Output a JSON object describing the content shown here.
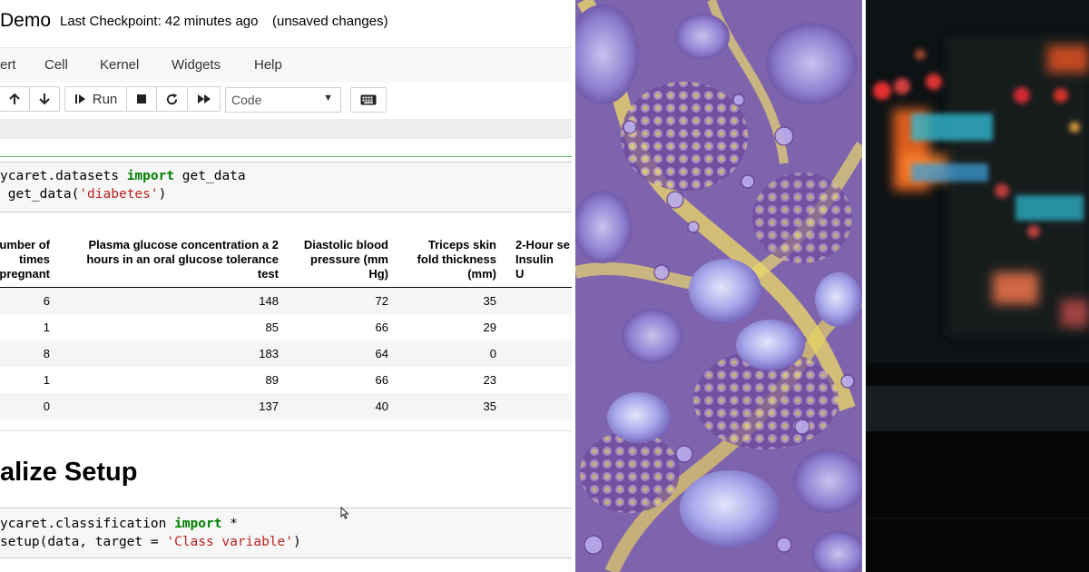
{
  "header": {
    "title": "Demo",
    "checkpoint": "Last Checkpoint: 42 minutes ago",
    "unsaved": "(unsaved changes)"
  },
  "menu": [
    "ert",
    "Cell",
    "Kernel",
    "Widgets",
    "Help"
  ],
  "toolbar": {
    "run_label": "Run",
    "cell_type": "Code",
    "icons": [
      "arrow-up-icon",
      "arrow-down-icon",
      "run-icon",
      "stop-icon",
      "restart-icon",
      "fast-forward-icon",
      "keyboard-icon"
    ]
  },
  "cells": {
    "load_data": {
      "line1_pre": "ycaret.datasets ",
      "line1_kw": "import",
      "line1_post": " get_data",
      "line2_pre": " get_data(",
      "line2_str": "'diabetes'",
      "line2_post": ")"
    },
    "setup": {
      "line1_pre": "ycaret.classification ",
      "line1_kw": "import",
      "line1_post": " *",
      "line2_pre": "setup(data, target = ",
      "line2_str": "'Class variable'",
      "line2_post": ")"
    }
  },
  "table": {
    "columns": [
      "umber of\ntimes\npregnant",
      "Plasma glucose concentration a 2\nhours in an oral glucose tolerance\ntest",
      "Diastolic blood\npressure (mm\nHg)",
      "Triceps skin\nfold thickness\n(mm)",
      "2-Hour se\nInsulin\nU"
    ],
    "rows": [
      [
        "6",
        "148",
        "72",
        "35"
      ],
      [
        "1",
        "85",
        "66",
        "29"
      ],
      [
        "8",
        "183",
        "64",
        "0"
      ],
      [
        "1",
        "89",
        "66",
        "23"
      ],
      [
        "0",
        "137",
        "40",
        "35"
      ]
    ]
  },
  "markdown": {
    "heading": "alize Setup"
  },
  "colors": {
    "keyword": "#008000",
    "string": "#ba2121",
    "running_cell_border": "#5cb85c"
  }
}
